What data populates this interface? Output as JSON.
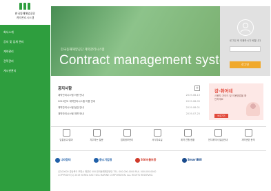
{
  "sidebar": {
    "logo_line1": "한국동해해양공단",
    "logo_line2": "계약관리시스템",
    "menu": [
      {
        "label": "회사소개"
      },
      {
        "label": "공지 및 업체 관리"
      },
      {
        "label": "계약관리"
      },
      {
        "label": "견적관리"
      },
      {
        "label": "게시판관리"
      }
    ],
    "color": "#2e9e3e"
  },
  "hero": {
    "subtitle": "한국동해해양공단 계약관리시스템",
    "title": "Contract management system"
  },
  "login": {
    "message": "로그인 후 이용하시기 바랍니다",
    "button_label": "로그인",
    "button_color": "#f0a92c"
  },
  "notice": {
    "title": "공지사항",
    "more": "+",
    "items": [
      {
        "title": "계약관리시스템 이용 안내",
        "date": "2019-08-13"
      },
      {
        "title": "2019년도 계약관리시스템 이용 안내",
        "date": "2019-08-05"
      },
      {
        "title": "계약관리시스템 점검 안내",
        "date": "2019-08-01"
      },
      {
        "title": "계약관리시스템 개편 안내",
        "date": "2019-07-25"
      }
    ]
  },
  "banner": {
    "title": "강·취어네",
    "text": "사용자 가이드 및 이용방법을 확인하세요",
    "button_label": "바로가기",
    "color": "#e24a3c"
  },
  "quick_links": [
    {
      "label": "입찰공고/결과",
      "icon": "user-icon"
    },
    {
      "label": "자주하는 질문",
      "icon": "question-icon"
    },
    {
      "label": "업체정보관리",
      "icon": "people-icon"
    },
    {
      "label": "서식자료실",
      "icon": "document-icon"
    },
    {
      "label": "계약 진행 현황",
      "icon": "report-icon"
    },
    {
      "label": "전자계약서 발급안내",
      "icon": "calculator-icon"
    },
    {
      "label": "계약관련 문의",
      "icon": "edit-icon"
    }
  ],
  "partners": [
    {
      "name": "나라장터",
      "color": "#1f5fa8"
    },
    {
      "name": "중소기업청",
      "color": "#1f5fa8"
    },
    {
      "name": "SGI서울보증",
      "color": "#d03a2a"
    },
    {
      "name": "SmartBill",
      "color": "#1a4b8c"
    }
  ],
  "footer": {
    "line1": "(우)00000 경상북도 포항시 해양로 000 한국동해해양공단 TEL. 000-000-0000 FAX. 000-000-0000",
    "line2": "COPYRIGHT(C) 2019 KOREA EAST SEA MARINE CORPORATION. ALL RIGHTS RESERVED."
  }
}
